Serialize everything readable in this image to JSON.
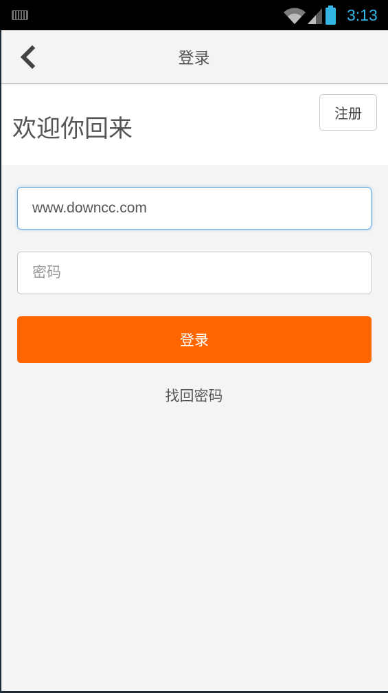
{
  "status_bar": {
    "time": "3:13",
    "accent_color": "#33b5e5",
    "icons": [
      "keyboard-icon",
      "wifi-icon",
      "signal-icon",
      "battery-icon"
    ]
  },
  "nav": {
    "back_icon": "chevron-left-icon",
    "title": "登录"
  },
  "welcome": {
    "title": "欢迎你回来",
    "register_label": "注册"
  },
  "form": {
    "username_value": "www.downcc.com",
    "password_placeholder": "密码",
    "login_label": "登录",
    "login_color": "#ff6600",
    "forgot_label": "找回密码"
  }
}
